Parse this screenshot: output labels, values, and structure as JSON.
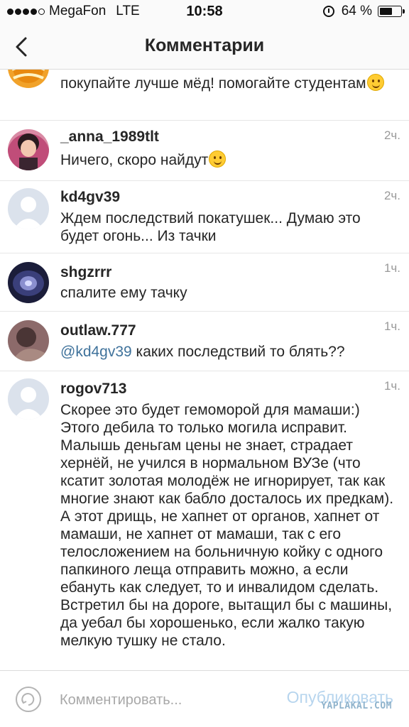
{
  "status_bar": {
    "carrier": "MegaFon",
    "network": "LTE",
    "time": "10:58",
    "battery_text": "64 %",
    "battery_level": 0.64,
    "signal_bars_filled": 4,
    "signal_bars_total": 5
  },
  "header": {
    "title": "Комментарии",
    "back_icon": "chevron-left-icon"
  },
  "comments": [
    {
      "username": "",
      "time": "",
      "text": "покупайте лучше мёд! помогайте студентам",
      "emoji": "wink-emoji"
    },
    {
      "username": "_anna_1989tlt",
      "time": "2ч.",
      "text": "Ничего, скоро найдут",
      "emoji": "smile-emoji"
    },
    {
      "username": "kd4gv39",
      "time": "2ч.",
      "text": "Ждем последствий покатушек... Думаю это будет огонь... Из тачки"
    },
    {
      "username": "shgzrrr",
      "time": "1ч.",
      "text": "спалите ему тачку"
    },
    {
      "username": "outlaw.777",
      "time": "1ч.",
      "mention": "@kd4gv39",
      "text": " каких последствий то блять??"
    },
    {
      "username": "rogov713",
      "time": "1ч.",
      "text": "Скорее это будет гемоморой для мамаши:) Этого дебила то только могила исправит. Малышь деньгам цены не знает, страдает хернёй, не учился в нормальном ВУЗе (что ксатит золотая молодёж не игнорирует, так как многие знают как бабло досталось их предкам). А этот дрищь, не хапнет от органов, хапнет от мамаши, не хапнет от мамаши, так с его телосложением на больничную койку с одного папкиного леща отправить можно, а если ебануть как следует, то и инвалидом сделать. Встретил бы на дороге, вытащил бы с машины, да уебал бы хорошенько, если жалко такую мелкую тушку не стало."
    }
  ],
  "composer": {
    "placeholder": "Комментировать...",
    "publish_label": "Опубликовать",
    "watermark": "YAPLAKAL.COM"
  },
  "colors": {
    "mention": "#3f729b",
    "publish_disabled": "#b7d5ee",
    "time": "#999999"
  }
}
